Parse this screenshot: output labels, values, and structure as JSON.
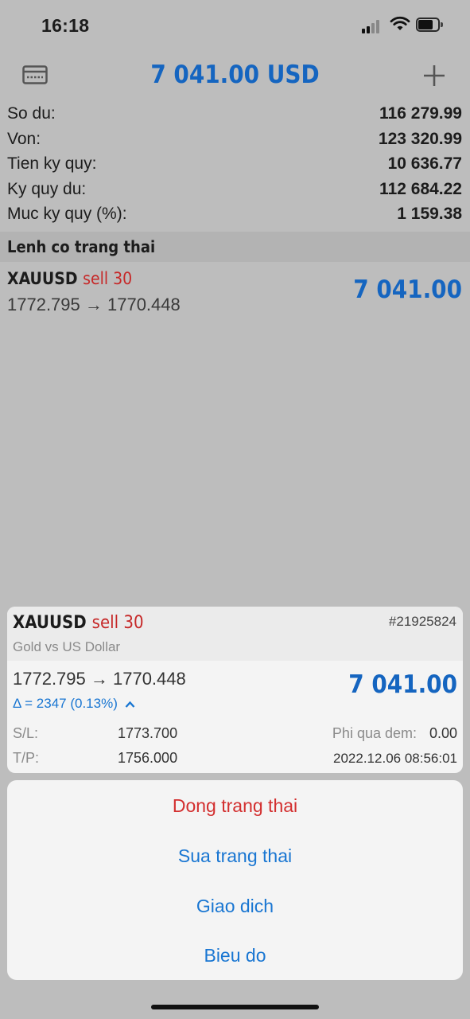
{
  "status_bar": {
    "time": "16:18"
  },
  "header": {
    "title": "7 041.00 USD",
    "left_icon": "card-icon",
    "right_icon": "plus-icon"
  },
  "account": [
    {
      "label": "So du:",
      "value": "116 279.99"
    },
    {
      "label": "Von:",
      "value": "123 320.99"
    },
    {
      "label": "Tien ky quy:",
      "value": "10 636.77"
    },
    {
      "label": "Ky quy du:",
      "value": "112 684.22"
    },
    {
      "label": "Muc ky quy (%):",
      "value": "1 159.38"
    }
  ],
  "positions_section": {
    "title": "Lenh co trang thai"
  },
  "position": {
    "symbol": "XAUUSD",
    "side": "sell 30",
    "prices": "1772.795 → 1770.448",
    "profit": "7 041.00"
  },
  "detail": {
    "symbol": "XAUUSD",
    "side": "sell 30",
    "ticket": "#21925824",
    "description": "Gold vs US Dollar",
    "prices": "1772.795 → 1770.448",
    "profit": "7 041.00",
    "delta": "Δ = 2347 (0.13%)",
    "sl_label": "S/L:",
    "sl_value": "1773.700",
    "tp_label": "T/P:",
    "tp_value": "1756.000",
    "swap_label": "Phi qua dem:",
    "swap_value": "0.00",
    "open_time": "2022.12.06 08:56:01"
  },
  "actions": [
    {
      "label": "Dong trang thai",
      "style": "destructive",
      "color": "#d32f2f"
    },
    {
      "label": "Sua trang thai",
      "color": "#1976d2"
    },
    {
      "label": "Giao dich",
      "color": "#1976d2"
    },
    {
      "label": "Bieu do",
      "color": "#1976d2"
    }
  ],
  "colors": {
    "accent": "#1565c0",
    "sell": "#c62828",
    "background_dimmed": "#bdbdbd"
  }
}
